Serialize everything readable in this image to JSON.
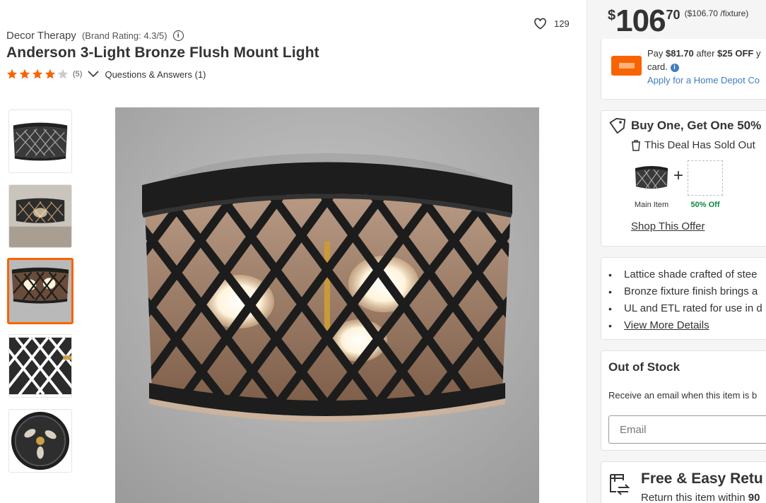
{
  "product": {
    "brand": "Decor Therapy",
    "brand_rating": "(Brand Rating: 4.3/5)",
    "title": "Anderson 3-Light Bronze Flush Mount Light",
    "stars": 4,
    "reviews_count": "(5)",
    "qa_link": "Questions & Answers (1)",
    "favorites": "129"
  },
  "thumbnails": [
    {
      "label": "thumbnail-1",
      "active": false
    },
    {
      "label": "thumbnail-2",
      "active": false
    },
    {
      "label": "thumbnail-3",
      "active": true
    },
    {
      "label": "thumbnail-4",
      "active": false
    },
    {
      "label": "thumbnail-5",
      "active": false
    }
  ],
  "price": {
    "dollar_sign": "$",
    "dollars": "106",
    "cents": "70",
    "per_unit": "($106.70 /fixture)"
  },
  "card_offer": {
    "pay": "Pay ",
    "pay_amount": "$81.70",
    "after": " after ",
    "off_amount": "$25 OFF",
    "tail": " y",
    "line2": "card.",
    "apply": "Apply for a Home Depot Co"
  },
  "bogo": {
    "title": "Buy One, Get One 50%",
    "sold_out": "This Deal Has Sold Out",
    "main_item": "Main Item",
    "off_label": "50% Off",
    "shop_link": "Shop This Offer"
  },
  "highlights": {
    "items": [
      "Lattice shade crafted of stee",
      "Bronze fixture finish brings a",
      "UL and ETL rated for use in d"
    ],
    "view_more": "View More Details"
  },
  "stock": {
    "title": "Out of Stock",
    "text": "Receive an email when this item is b",
    "email_placeholder": "Email"
  },
  "returns": {
    "title": "Free & Easy Retu",
    "sub_prefix": "Return this item within ",
    "sub_bold": "90"
  },
  "colors": {
    "accent_orange": "#f96302",
    "link_blue": "#3e7dc0",
    "success_green": "#0a8a3a"
  }
}
